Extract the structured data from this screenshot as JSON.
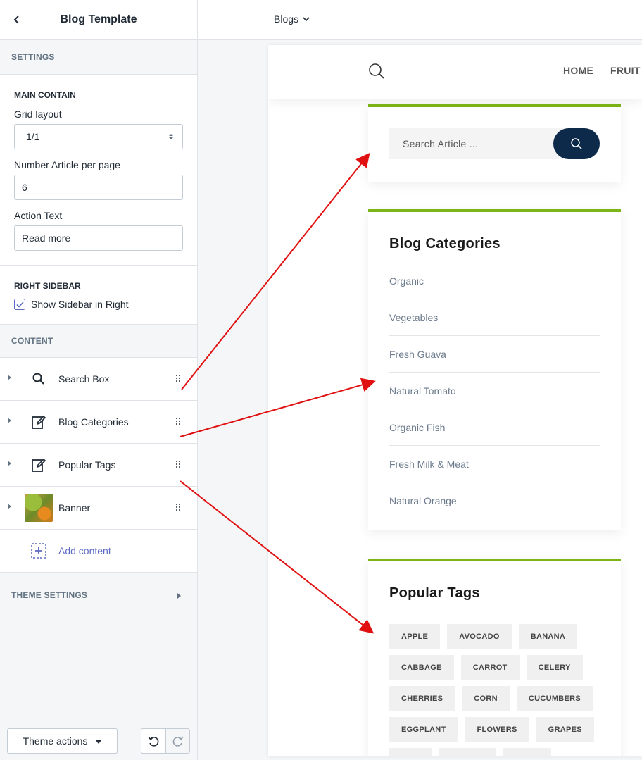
{
  "panel": {
    "title": "Blog Template",
    "settings_title": "SETTINGS",
    "main_contain": {
      "heading": "MAIN CONTAIN",
      "grid_layout_label": "Grid layout",
      "grid_layout_value": "1/1",
      "articles_label": "Number Article per page",
      "articles_value": "6",
      "action_text_label": "Action Text",
      "action_text_value": "Read more"
    },
    "right_sidebar": {
      "heading": "RIGHT SIDEBAR",
      "show_sidebar_label": "Show Sidebar in Right",
      "show_sidebar_checked": true
    },
    "content_title": "CONTENT",
    "content_items": [
      {
        "label": "Search Box",
        "icon": "search-icon"
      },
      {
        "label": "Blog Categories",
        "icon": "edit-icon"
      },
      {
        "label": "Popular Tags",
        "icon": "edit-icon"
      },
      {
        "label": "Banner",
        "icon": "banner-thumbnail"
      }
    ],
    "add_content_label": "Add content",
    "theme_settings_title": "THEME SETTINGS",
    "footer": {
      "theme_actions_label": "Theme actions"
    }
  },
  "topbar": {
    "page_selector": "Blogs"
  },
  "preview": {
    "nav": [
      "HOME",
      "FRUIT"
    ],
    "search_placeholder": "Search Article ...",
    "categories_title": "Blog Categories",
    "categories": [
      "Organic",
      "Vegetables",
      "Fresh Guava",
      "Natural Tomato",
      "Organic Fish",
      "Fresh Milk & Meat",
      "Natural Orange"
    ],
    "tags_title": "Popular Tags",
    "tags": [
      "APPLE",
      "AVOCADO",
      "BANANA",
      "CABBAGE",
      "CARROT",
      "CELERY",
      "CHERRIES",
      "CORN",
      "CUCUMBERS",
      "EGGPLANT",
      "FLOWERS",
      "GRAPES"
    ]
  },
  "colors": {
    "accent_green": "#7cb518",
    "search_button": "#0d2a4a",
    "annotation_arrow": "#e01010",
    "link_purple": "#5c6ac4"
  }
}
